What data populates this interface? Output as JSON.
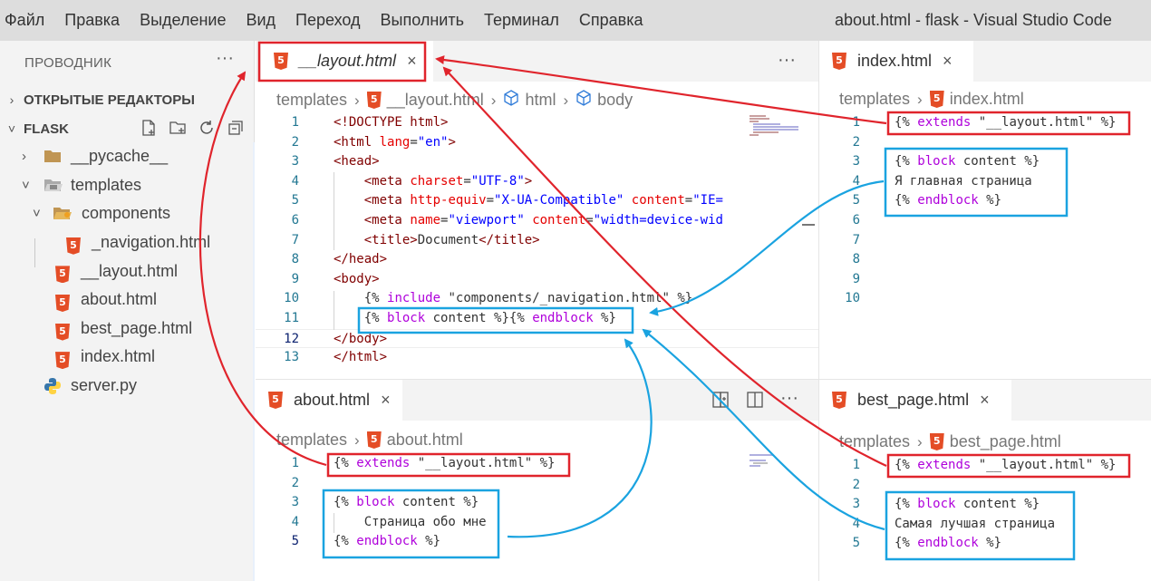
{
  "menu": {
    "items": [
      "Файл",
      "Правка",
      "Выделение",
      "Вид",
      "Переход",
      "Выполнить",
      "Терминал",
      "Справка"
    ],
    "window_title": "about.html - flask - Visual Studio Code"
  },
  "explorer": {
    "header": "ПРОВОДНИК",
    "more": "···",
    "open_editors": "ОТКРЫТЫЕ РЕДАКТОРЫ",
    "project": "FLASK",
    "tree": [
      {
        "label": "__pycache__",
        "icon": "folder-icon",
        "chevron": "›"
      },
      {
        "label": "templates",
        "icon": "folder-open-icon",
        "chevron": "˅"
      },
      {
        "label": "components",
        "icon": "folder-open-icon",
        "chevron": "˅"
      },
      {
        "label": "_navigation.html",
        "icon": "html5-icon"
      },
      {
        "label": "__layout.html",
        "icon": "html5-icon"
      },
      {
        "label": "about.html",
        "icon": "html5-icon"
      },
      {
        "label": "best_page.html",
        "icon": "html5-icon"
      },
      {
        "label": "index.html",
        "icon": "html5-icon"
      },
      {
        "label": "server.py",
        "icon": "python-icon"
      }
    ]
  },
  "editors": {
    "layout": {
      "tab": "__layout.html",
      "close": "×",
      "more": "···",
      "crumbs": [
        "templates",
        "__layout.html",
        "html",
        "body"
      ],
      "lines": [
        {
          "n": "1",
          "text": "<!DOCTYPE html>"
        },
        {
          "n": "2",
          "text": "<html lang=\"en\">"
        },
        {
          "n": "3",
          "text": "<head>"
        },
        {
          "n": "4",
          "text": "    <meta charset=\"UTF-8\">"
        },
        {
          "n": "5",
          "text": "    <meta http-equiv=\"X-UA-Compatible\" content=\"IE="
        },
        {
          "n": "6",
          "text": "    <meta name=\"viewport\" content=\"width=device-wid"
        },
        {
          "n": "7",
          "text": "    <title>Document</title>"
        },
        {
          "n": "8",
          "text": "</head>"
        },
        {
          "n": "9",
          "text": "<body>"
        },
        {
          "n": "10",
          "text": "    {% include \"components/_navigation.html\" %}"
        },
        {
          "n": "11",
          "text": "    {% block content %}{% endblock %}"
        },
        {
          "n": "12",
          "text": "</body>"
        },
        {
          "n": "13",
          "text": "</html>"
        }
      ]
    },
    "index": {
      "tab": "index.html",
      "close": "×",
      "crumbs": [
        "templates",
        "index.html"
      ],
      "lines": [
        {
          "n": "1",
          "text": "{% extends \"__layout.html\" %}"
        },
        {
          "n": "2",
          "text": ""
        },
        {
          "n": "3",
          "text": "{% block content %}"
        },
        {
          "n": "4",
          "text": "Я главная страница"
        },
        {
          "n": "5",
          "text": "{% endblock %}"
        },
        {
          "n": "6",
          "text": ""
        },
        {
          "n": "7",
          "text": ""
        },
        {
          "n": "8",
          "text": ""
        },
        {
          "n": "9",
          "text": ""
        },
        {
          "n": "10",
          "text": ""
        }
      ]
    },
    "about": {
      "tab": "about.html",
      "close": "×",
      "more": "···",
      "crumbs": [
        "templates",
        "about.html"
      ],
      "lines": [
        {
          "n": "1",
          "text": "{% extends \"__layout.html\" %}"
        },
        {
          "n": "2",
          "text": ""
        },
        {
          "n": "3",
          "text": "{% block content %}"
        },
        {
          "n": "4",
          "text": "    Страница обо мне"
        },
        {
          "n": "5",
          "text": "{% endblock %}"
        }
      ]
    },
    "best": {
      "tab": "best_page.html",
      "close": "×",
      "crumbs": [
        "templates",
        "best_page.html"
      ],
      "lines": [
        {
          "n": "1",
          "text": "{% extends \"__layout.html\" %}"
        },
        {
          "n": "2",
          "text": ""
        },
        {
          "n": "3",
          "text": "{% block content %}"
        },
        {
          "n": "4",
          "text": "Самая лучшая страница"
        },
        {
          "n": "5",
          "text": "{% endblock %}"
        }
      ]
    }
  },
  "colors": {
    "extends_box": "#e0242c",
    "block_box": "#1aa3e0",
    "html5": "#e44d26"
  }
}
